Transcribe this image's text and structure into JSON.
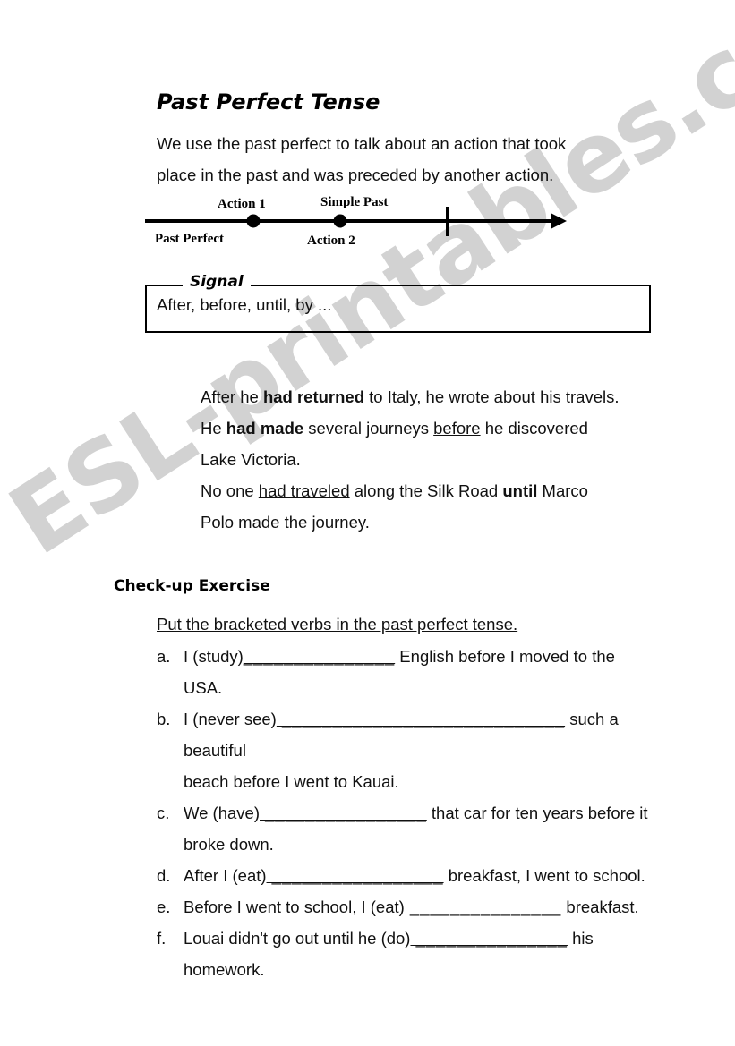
{
  "watermark": {
    "text": "ESL-printables.com",
    "color": "#d2d2d2"
  },
  "title": "Past Perfect Tense",
  "intro": {
    "line1": "We use the past perfect to talk about an action that took",
    "line2": "place in the past and was preceded by another action."
  },
  "timeline": {
    "label_action1": "Action 1",
    "label_simple_past": "Simple Past",
    "label_past_perfect": "Past Perfect",
    "label_action2": "Action 2"
  },
  "signal": {
    "legend": "Signal",
    "content": "After, before, until, by ..."
  },
  "examples": {
    "s1_a": "After",
    "s1_b": " he ",
    "s1_c": "had returned",
    "s1_d": " to Italy, he wrote about his travels.",
    "s2_a": "He ",
    "s2_b": "had made",
    "s2_c": " several journeys ",
    "s2_d": "before",
    "s2_e": " he discovered",
    "s2_f": "Lake Victoria.",
    "s3_a": "No one ",
    "s3_b": "had traveled",
    "s3_c": " along the Silk Road ",
    "s3_d": "until",
    "s3_e": " Marco",
    "s3_f": "Polo made the journey."
  },
  "exercise": {
    "heading": "Check-up Exercise",
    "instruction": "Put the bracketed verbs in the past perfect tense.",
    "items": [
      {
        "marker": "a.",
        "pre": "I (study)",
        "blank": "_______________",
        "post": " English before I moved to the",
        "cont": "USA."
      },
      {
        "marker": "b.",
        "pre": "I (never see)",
        "blank": " ____________________________",
        "post": " such a beautiful",
        "cont": "beach before I went to Kauai."
      },
      {
        "marker": "c.",
        "pre": "We (have)",
        "blank": " ________________",
        "post": " that car for ten years before it",
        "cont": "broke down."
      },
      {
        "marker": "d.",
        "pre": "After I (eat)",
        "blank": " _________________",
        "post": " breakfast, I went to school.",
        "cont": ""
      },
      {
        "marker": "e.",
        "pre": "Before I went to school, I (eat)",
        "blank": " _______________",
        "post": " breakfast.",
        "cont": ""
      },
      {
        "marker": "f.",
        "pre": "Louai didn't go out until he (do)",
        "blank": " _______________",
        "post": " his",
        "cont": "homework."
      }
    ]
  }
}
